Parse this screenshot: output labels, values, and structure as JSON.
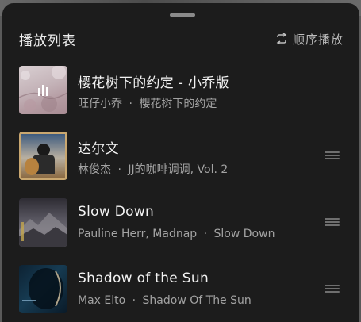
{
  "playlist": {
    "title": "播放列表",
    "play_mode_label": "顺序播放",
    "play_mode_icon": "repeat-icon",
    "items": [
      {
        "title": "樱花树下的约定 - 小乔版",
        "artist": "旺仔小乔",
        "album": "樱花树下的约定",
        "separator": "·",
        "playing": true,
        "playing_icon": "now-playing-bars-icon"
      },
      {
        "title": "达尔文",
        "artist": "林俊杰",
        "album": "JJ的咖啡调调, Vol. 2",
        "separator": "·",
        "playing": false
      },
      {
        "title": "Slow Down",
        "artist": "Pauline Herr, Madnap",
        "album": "Slow Down",
        "separator": "·",
        "playing": false
      },
      {
        "title": "Shadow of the Sun",
        "artist": "Max Elto",
        "album": "Shadow Of The Sun",
        "separator": "·",
        "playing": false
      }
    ]
  },
  "colors": {
    "background": "#1c1c1c",
    "primary_text": "#f2f2f2",
    "secondary_text": "#a3a3a3"
  }
}
